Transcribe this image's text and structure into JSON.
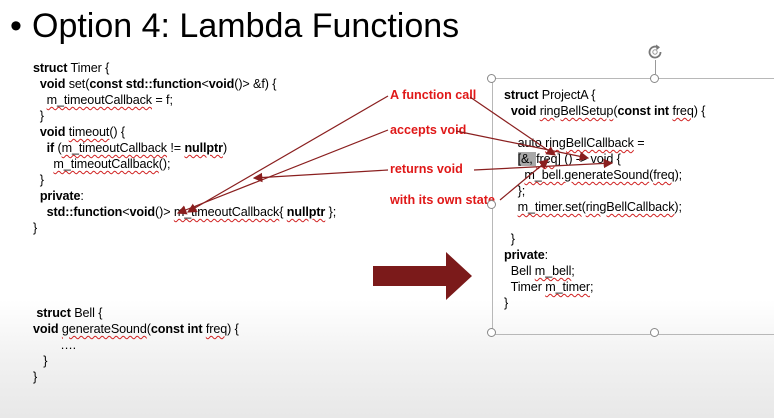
{
  "slide": {
    "title": "Option 4: Lambda Functions",
    "bullet": "•"
  },
  "timer": {
    "lines": [
      [
        {
          "t": "struct",
          "b": 1
        },
        {
          "t": " Timer {"
        }
      ],
      [
        {
          "t": "  "
        },
        {
          "t": "void",
          "b": 1
        },
        {
          "t": " set("
        },
        {
          "t": "const std::function",
          "b": 1
        },
        {
          "t": "<"
        },
        {
          "t": "void",
          "b": 1
        },
        {
          "t": "()> &f) {"
        }
      ],
      [
        {
          "t": "    "
        },
        {
          "t": "m_timeoutCallback",
          "s": 1
        },
        {
          "t": " = f;"
        }
      ],
      [
        {
          "t": "  }"
        }
      ],
      [
        {
          "t": "  "
        },
        {
          "t": "void",
          "b": 1
        },
        {
          "t": " "
        },
        {
          "t": "timeout",
          "s": 1
        },
        {
          "t": "() {"
        }
      ],
      [
        {
          "t": "    "
        },
        {
          "t": "if",
          "b": 1
        },
        {
          "t": " ("
        },
        {
          "t": "m_timeoutCallback",
          "s": 1
        },
        {
          "t": " != "
        },
        {
          "t": "nullptr",
          "b": 1,
          "s": 1
        },
        {
          "t": ")"
        }
      ],
      [
        {
          "t": "      "
        },
        {
          "t": "m_timeoutCallback",
          "s": 1
        },
        {
          "t": "();"
        }
      ],
      [
        {
          "t": "  }"
        }
      ],
      [
        {
          "t": "  "
        },
        {
          "t": "private",
          "b": 1
        },
        {
          "t": ":"
        }
      ],
      [
        {
          "t": "    "
        },
        {
          "t": "std::function",
          "b": 1
        },
        {
          "t": "<"
        },
        {
          "t": "void",
          "b": 1
        },
        {
          "t": "()> "
        },
        {
          "t": "m_timeoutCallback",
          "s": 1
        },
        {
          "t": "{ "
        },
        {
          "t": "nullptr",
          "b": 1,
          "s": 1
        },
        {
          "t": " };"
        }
      ],
      [
        {
          "t": "}"
        }
      ]
    ]
  },
  "bell": {
    "lines": [
      [
        {
          "t": " "
        },
        {
          "t": "struct",
          "b": 1
        },
        {
          "t": " Bell {"
        }
      ],
      [
        {
          "t": "void",
          "b": 1
        },
        {
          "t": " "
        },
        {
          "t": "generateSound",
          "s": 1
        },
        {
          "t": "("
        },
        {
          "t": "const int",
          "b": 1
        },
        {
          "t": " "
        },
        {
          "t": "freq",
          "s": 1
        },
        {
          "t": ") {"
        }
      ],
      [
        {
          "t": "        …."
        }
      ],
      [
        {
          "t": "   }"
        }
      ],
      [
        {
          "t": "}"
        }
      ]
    ]
  },
  "project": {
    "lines": [
      [
        {
          "t": "struct",
          "b": 1
        },
        {
          "t": " ProjectA {"
        }
      ],
      [
        {
          "t": "  "
        },
        {
          "t": "void",
          "b": 1
        },
        {
          "t": " "
        },
        {
          "t": "ringBellSetup",
          "s": 1
        },
        {
          "t": "("
        },
        {
          "t": "const int",
          "b": 1
        },
        {
          "t": " "
        },
        {
          "t": "freq",
          "s": 1
        },
        {
          "t": ") {"
        }
      ],
      [
        {
          "t": ""
        }
      ],
      [
        {
          "t": "    auto "
        },
        {
          "t": "ringBellCallback",
          "s": 1
        },
        {
          "t": " ="
        }
      ],
      [
        {
          "t": "    "
        },
        {
          "t": "[&, ",
          "h": 1
        },
        {
          "t": "freq",
          "s": 1
        },
        {
          "t": "] () -> void {"
        }
      ],
      [
        {
          "t": "      "
        },
        {
          "t": "m_bell.generateSound",
          "s": 1
        },
        {
          "t": "("
        },
        {
          "t": "freq",
          "s": 1
        },
        {
          "t": ");"
        }
      ],
      [
        {
          "t": "    };"
        }
      ],
      [
        {
          "t": "    "
        },
        {
          "t": "m_timer.set",
          "s": 1
        },
        {
          "t": "("
        },
        {
          "t": "ringBellCallback",
          "s": 1
        },
        {
          "t": ");"
        }
      ],
      [
        {
          "t": ""
        }
      ],
      [
        {
          "t": "  }"
        }
      ],
      [
        {
          "t": "private",
          "b": 1
        },
        {
          "t": ":"
        }
      ],
      [
        {
          "t": "  Bell "
        },
        {
          "t": "m_bell",
          "s": 1
        },
        {
          "t": ";"
        }
      ],
      [
        {
          "t": "  Timer "
        },
        {
          "t": "m_timer",
          "s": 1
        },
        {
          "t": ";"
        }
      ],
      [
        {
          "t": "}"
        }
      ]
    ]
  },
  "annotations": {
    "function_call": "A function call",
    "accepts_void": "accepts void",
    "returns_void": "returns void",
    "own_state": "with its own state"
  },
  "colors": {
    "annotation_red": "#e01818",
    "arrow_maroon": "#7b1a1a",
    "squiggle": "#d02020"
  },
  "icons": {
    "rotate_handle": "rotate-icon"
  }
}
